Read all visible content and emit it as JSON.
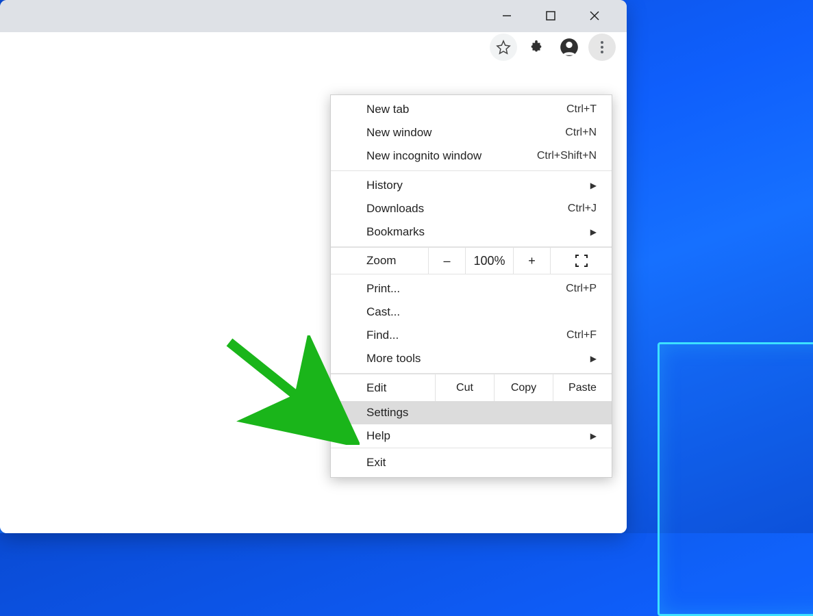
{
  "window": {
    "minimize": "—",
    "maximize": "□",
    "close": "✕"
  },
  "toolbar": {
    "star": "☆",
    "extensions": "puzzle",
    "profile": "person",
    "menu": "⋮"
  },
  "menu": {
    "group1": [
      {
        "label": "New tab",
        "shortcut": "Ctrl+T"
      },
      {
        "label": "New window",
        "shortcut": "Ctrl+N"
      },
      {
        "label": "New incognito window",
        "shortcut": "Ctrl+Shift+N"
      }
    ],
    "group2": [
      {
        "label": "History",
        "submenu": true
      },
      {
        "label": "Downloads",
        "shortcut": "Ctrl+J"
      },
      {
        "label": "Bookmarks",
        "submenu": true
      }
    ],
    "zoom": {
      "label": "Zoom",
      "minus": "–",
      "value": "100%",
      "plus": "+",
      "fullscreen": "⛶"
    },
    "group3": [
      {
        "label": "Print...",
        "shortcut": "Ctrl+P"
      },
      {
        "label": "Cast..."
      },
      {
        "label": "Find...",
        "shortcut": "Ctrl+F"
      },
      {
        "label": "More tools",
        "submenu": true
      }
    ],
    "edit": {
      "label": "Edit",
      "cut": "Cut",
      "copy": "Copy",
      "paste": "Paste"
    },
    "group4": [
      {
        "label": "Settings",
        "highlight": true
      },
      {
        "label": "Help",
        "submenu": true
      }
    ],
    "group5": [
      {
        "label": "Exit"
      }
    ]
  },
  "annotation": {
    "color": "#1ab51a"
  }
}
